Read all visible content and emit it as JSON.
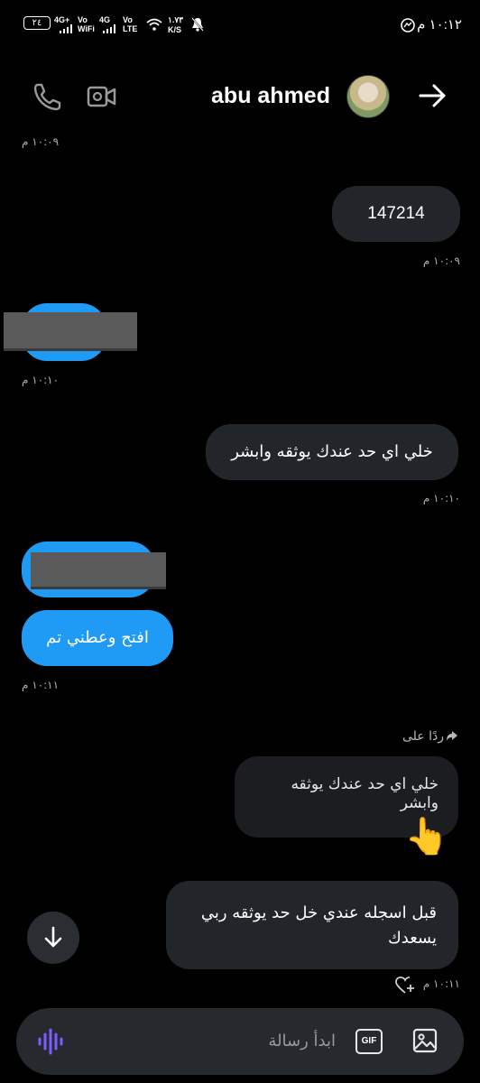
{
  "status_bar": {
    "battery": "٢٤",
    "net1": "4G+",
    "vowifi_top": "Vo",
    "vowifi_bottom": "WiFi",
    "net2": "4G",
    "volte_top": "Vo",
    "volte_bottom": "LTE",
    "speed_value": "١.٧٣",
    "speed_unit": "K/S",
    "time": "١٠:١٢ م"
  },
  "header": {
    "contact_name": "abu ahmed",
    "icons": [
      "back-arrow-icon",
      "avatar",
      "video-call-icon",
      "phone-call-icon"
    ]
  },
  "messages": {
    "ts1": "١٠:٠٩ م",
    "m1_text": "147214",
    "ts2": "١٠:٠٩ م",
    "ts3": "١٠:١٠ م",
    "m3_text": "خلي اي حد عندك يوثقه وابشر",
    "ts4": "١٠:١٠ م",
    "m5_text": "افتح وعطني تم",
    "ts5": "١٠:١١ م",
    "replied_label": "ردًا على",
    "reply_quote": "خلي اي حد عندك يوثقه وابشر",
    "reply_emoji": "👆",
    "m6_text": "قبل اسجله عندي خل حد يوثقه ربي يسعدك",
    "ts6": "١٠:١١ م"
  },
  "composer": {
    "placeholder": "ابدأ رسالة",
    "gif_label": "GIF"
  },
  "colors": {
    "background": "#000000",
    "incoming_bubble": "#1f9bf5",
    "outgoing_bubble": "#22252a",
    "voice_icon": "#7b5cff"
  }
}
